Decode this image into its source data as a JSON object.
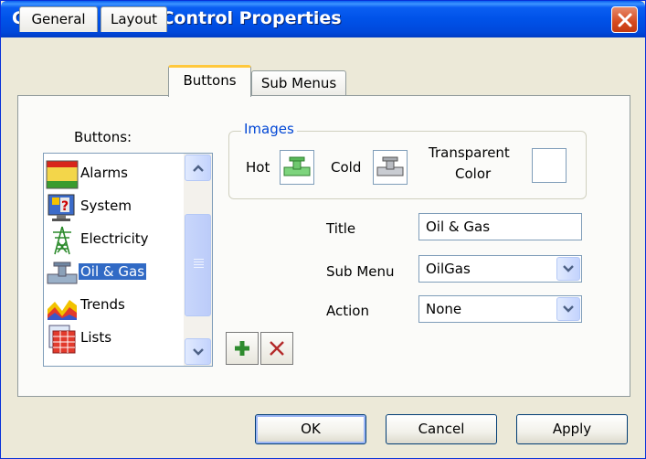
{
  "window": {
    "title": "Catapult Menu Control Properties"
  },
  "tabs": [
    {
      "label": "General"
    },
    {
      "label": "Layout"
    },
    {
      "label": "Buttons"
    },
    {
      "label": "Sub Menus"
    }
  ],
  "buttons_panel": {
    "label": "Buttons:",
    "items": [
      {
        "label": "Alarms",
        "icon": "alarms-icon"
      },
      {
        "label": "System",
        "icon": "system-icon"
      },
      {
        "label": "Electricity",
        "icon": "electricity-icon"
      },
      {
        "label": "Oil & Gas",
        "icon": "oil-gas-icon",
        "selected": true
      },
      {
        "label": "Trends",
        "icon": "trends-icon"
      },
      {
        "label": "Lists",
        "icon": "lists-icon"
      }
    ]
  },
  "images": {
    "legend": "Images",
    "hot_label": "Hot",
    "cold_label": "Cold",
    "transparent_label_line1": "Transparent",
    "transparent_label_line2": "Color"
  },
  "fields": {
    "title_label": "Title",
    "title_value": "Oil & Gas",
    "submenu_label": "Sub Menu",
    "submenu_value": "OilGas",
    "action_label": "Action",
    "action_value": "None"
  },
  "dialog_buttons": {
    "ok": "OK",
    "cancel": "Cancel",
    "apply": "Apply"
  },
  "colors": {
    "accent": "#0052e8",
    "selection": "#316ac5",
    "legend": "#0046d5"
  }
}
